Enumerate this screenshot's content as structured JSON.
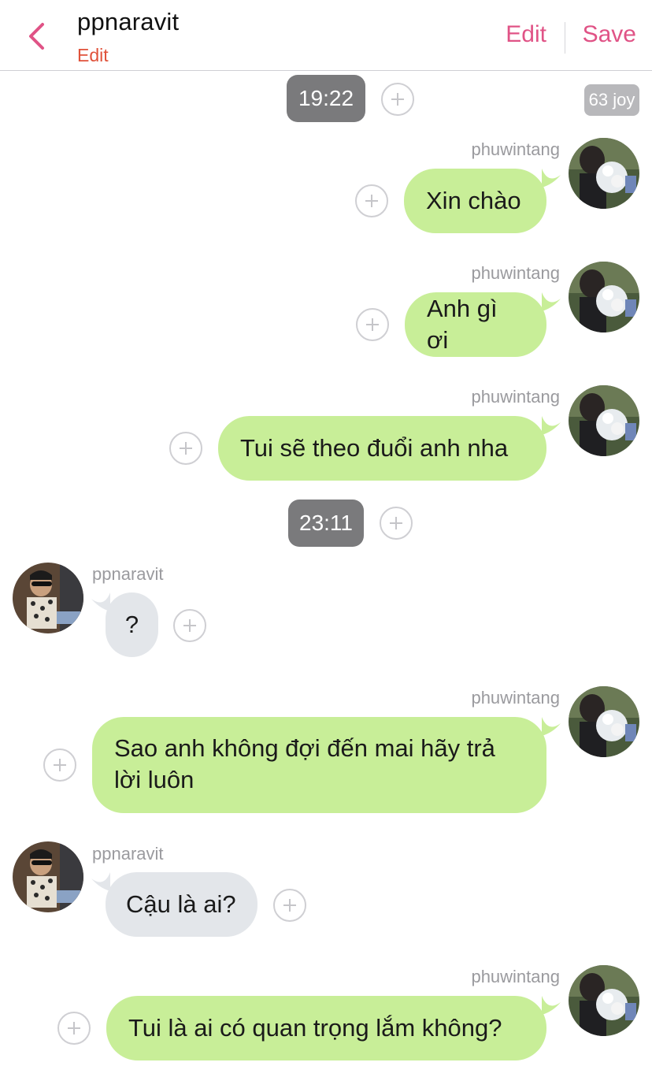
{
  "header": {
    "title": "ppnaravit",
    "sub_label": "Edit",
    "edit_label": "Edit",
    "save_label": "Save"
  },
  "badge": {
    "counter": "63 joy"
  },
  "times": [
    "19:22",
    "23:11"
  ],
  "messages": [
    {
      "sender": "phuwintang",
      "text": "Xin chào"
    },
    {
      "sender": "phuwintang",
      "text": "Anh gì ơi"
    },
    {
      "sender": "phuwintang",
      "text": "Tui sẽ theo đuổi anh nha"
    },
    {
      "sender": "ppnaravit",
      "text": "?"
    },
    {
      "sender": "phuwintang",
      "text": "Sao anh không đợi đến mai hãy trả lời luôn"
    },
    {
      "sender": "ppnaravit",
      "text": "Cậu là ai?"
    },
    {
      "sender": "phuwintang",
      "text": "Tui là ai có quan trọng lắm không?"
    }
  ],
  "colors": {
    "accent_pink": "#e05386",
    "edit_orange": "#e0523a",
    "my_bubble": "#c8ee98",
    "their_bubble": "#e3e6ea",
    "time_pill": "#7a7a7c"
  },
  "icons": {
    "back": "chevron-left-icon",
    "plus": "plus-circle-icon"
  }
}
